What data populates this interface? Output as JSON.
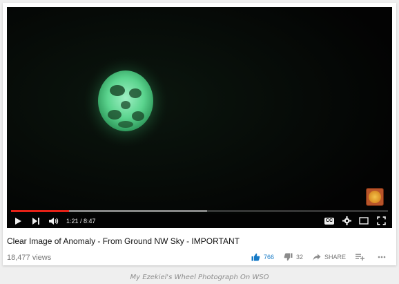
{
  "player": {
    "time_display": "1:21 / 8:47",
    "progress_played": 0.154,
    "progress_buffered": 0.52,
    "watermark_icon": "channel-watermark-icon",
    "colors": {
      "progress_played": "#e62117",
      "background": "#030303"
    }
  },
  "video": {
    "title": "Clear Image of Anomaly - From Ground NW Sky - IMPORTANT",
    "views": "18,477 views",
    "likes": "766",
    "dislikes": "32",
    "share_label": "SHARE"
  },
  "icons": {
    "play": "play-icon",
    "next": "next-icon",
    "volume": "volume-icon",
    "cc": "captions-icon",
    "settings": "gear-icon",
    "miniplayer": "miniplayer-icon",
    "fullscreen": "fullscreen-icon",
    "like": "thumbs-up-icon",
    "dislike": "thumbs-down-icon",
    "share": "share-icon",
    "add": "add-to-playlist-icon",
    "more": "more-icon"
  },
  "caption": "My Ezekiel's Wheel Photograph On WSO",
  "accent_color": "#167ac6"
}
